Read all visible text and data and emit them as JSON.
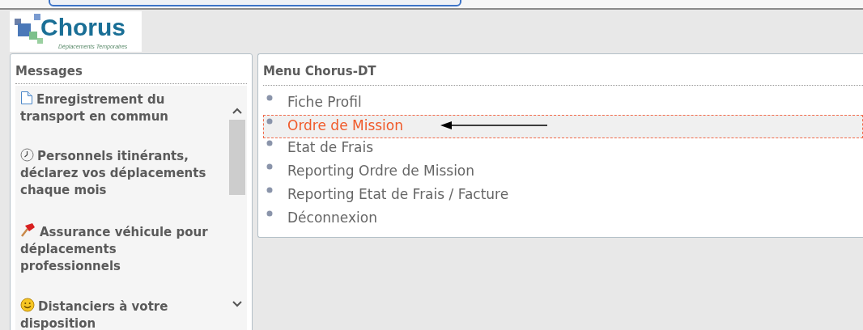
{
  "logo": {
    "name": "Chorus",
    "tagline": "Déplacements Temporaires"
  },
  "messages": {
    "title": "Messages",
    "items": [
      {
        "kind": "document",
        "text": "Enregistrement du transport en commun"
      },
      {
        "kind": "clock",
        "text": "Personnels itinérants, déclarez vos déplacements chaque mois"
      },
      {
        "kind": "pin",
        "text": "Assurance véhicule pour déplacements professionnels"
      },
      {
        "kind": "smiley",
        "text": "Distanciers à votre disposition"
      }
    ]
  },
  "menu": {
    "title": "Menu Chorus-DT",
    "items": [
      {
        "label": "Fiche Profil",
        "selected": false
      },
      {
        "label": "Ordre de Mission",
        "selected": true
      },
      {
        "label": "Etat de Frais",
        "selected": false
      },
      {
        "label": "Reporting Ordre de Mission",
        "selected": false
      },
      {
        "label": "Reporting Etat de Frais / Facture",
        "selected": false
      },
      {
        "label": "Déconnexion",
        "selected": false
      }
    ]
  }
}
